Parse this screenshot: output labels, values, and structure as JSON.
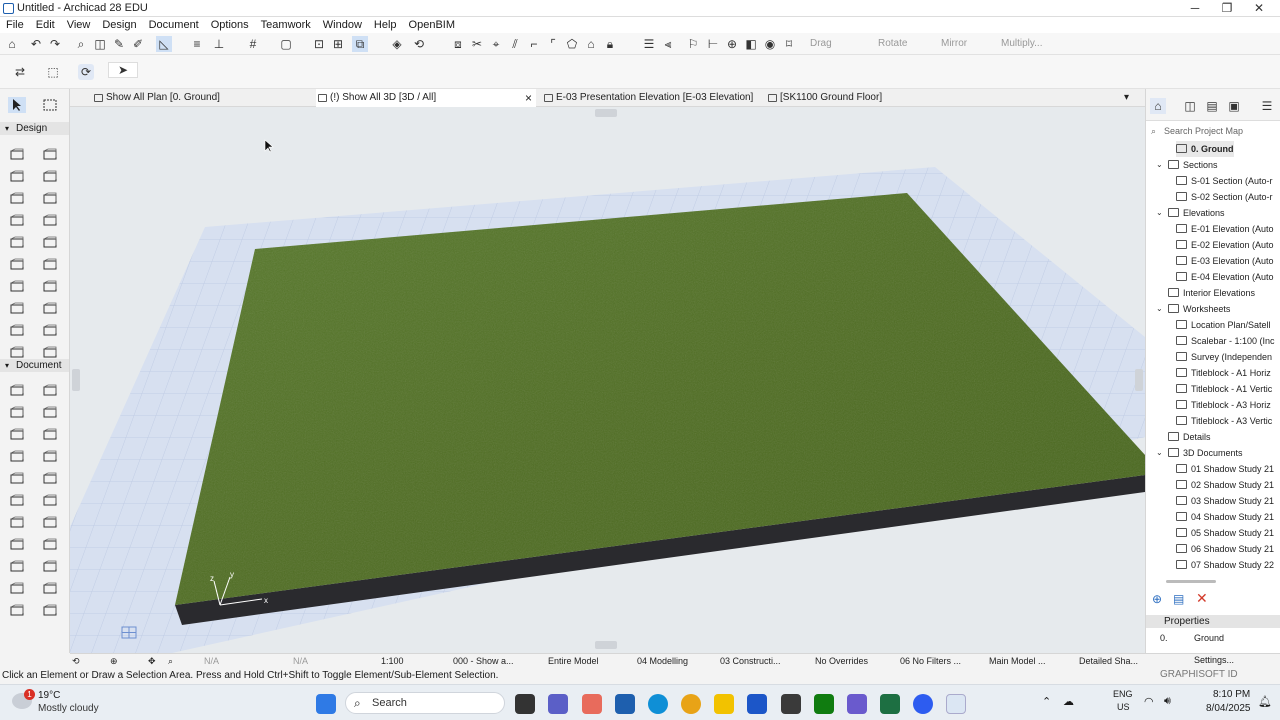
{
  "window": {
    "title": "Untitled - Archicad 28 EDU",
    "minimize": "─",
    "maximize": "❐",
    "close": "✕"
  },
  "menu": [
    "File",
    "Edit",
    "View",
    "Design",
    "Document",
    "Options",
    "Teamwork",
    "Window",
    "Help",
    "OpenBIM"
  ],
  "toolbar": {
    "drag": "Drag",
    "rotate": "Rotate",
    "mirror": "Mirror",
    "multiply": "Multiply..."
  },
  "tabs": [
    {
      "label": "Show All Plan [0. Ground]"
    },
    {
      "label": "(!) Show All 3D [3D / All]",
      "close": "×"
    },
    {
      "label": "E-03 Presentation Elevation [E-03 Elevation]"
    },
    {
      "label": "[SK1100 Ground Floor]"
    }
  ],
  "toolbox": {
    "design_header": "Design",
    "document_header": "Document"
  },
  "project_map": {
    "search_placeholder": "Search Project Map",
    "items": [
      {
        "label": "0. Ground",
        "level": 2,
        "bold": true
      },
      {
        "label": "Sections",
        "level": 1,
        "expanded": true
      },
      {
        "label": "S-01 Section (Auto-r",
        "level": 2
      },
      {
        "label": "S-02 Section (Auto-r",
        "level": 2
      },
      {
        "label": "Elevations",
        "level": 1,
        "expanded": true
      },
      {
        "label": "E-01 Elevation (Auto",
        "level": 2
      },
      {
        "label": "E-02 Elevation (Auto",
        "level": 2
      },
      {
        "label": "E-03 Elevation (Auto",
        "level": 2
      },
      {
        "label": "E-04 Elevation (Auto",
        "level": 2
      },
      {
        "label": "Interior Elevations",
        "level": 1
      },
      {
        "label": "Worksheets",
        "level": 1,
        "expanded": true
      },
      {
        "label": "Location Plan/Satell",
        "level": 2
      },
      {
        "label": "Scalebar - 1:100 (Inc",
        "level": 2
      },
      {
        "label": "Survey (Independen",
        "level": 2
      },
      {
        "label": "Titleblock - A1 Horiz",
        "level": 2
      },
      {
        "label": "Titleblock - A1 Vertic",
        "level": 2
      },
      {
        "label": "Titleblock - A3 Horiz",
        "level": 2
      },
      {
        "label": "Titleblock - A3 Vertic",
        "level": 2
      },
      {
        "label": "Details",
        "level": 1
      },
      {
        "label": "3D Documents",
        "level": 1,
        "expanded": true
      },
      {
        "label": "01 Shadow Study 21",
        "level": 2
      },
      {
        "label": "02 Shadow Study 21",
        "level": 2
      },
      {
        "label": "03 Shadow Study 21",
        "level": 2
      },
      {
        "label": "04 Shadow Study 21",
        "level": 2
      },
      {
        "label": "05 Shadow Study 21",
        "level": 2
      },
      {
        "label": "06 Shadow Study 21",
        "level": 2
      },
      {
        "label": "07 Shadow Study 22",
        "level": 2
      }
    ]
  },
  "properties": {
    "header": "Properties",
    "story_num": "0.",
    "story_name": "Ground",
    "settings": "Settings...",
    "brand": "GRAPHISOFT ID"
  },
  "statusbar": {
    "zoom_na1": "N/A",
    "zoom_na2": "N/A",
    "scale": "1:100",
    "layer_combo": "000 - Show a...",
    "model_view": "Entire Model",
    "pen_set": "04 Modelling",
    "mvo": "03 Constructi...",
    "overrides": "No Overrides",
    "renovation": "06 No Filters ...",
    "structure": "Main Model ...",
    "shading": "Detailed Sha..."
  },
  "hint": "Click an Element or Draw a Selection Area. Press and Hold Ctrl+Shift to Toggle Element/Sub-Element Selection.",
  "axes": {
    "x": "x",
    "y": "y",
    "z": "z"
  },
  "taskbar": {
    "weather_temp": "19°C",
    "weather_desc": "Mostly cloudy",
    "weather_badge": "1",
    "search": "Search",
    "lang1": "ENG",
    "lang2": "US",
    "time": "8:10 PM",
    "date": "8/04/2025"
  },
  "colors": {
    "accent": "#1e5fae",
    "grass": "#4f6d22",
    "slab_side": "#2a2a2e",
    "grid_floor": "#d3ddf0"
  }
}
